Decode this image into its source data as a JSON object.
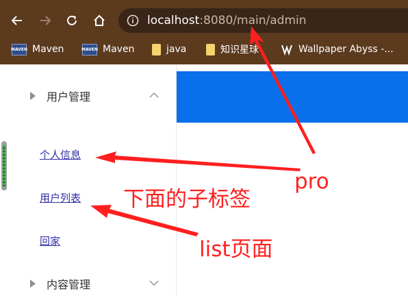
{
  "browser": {
    "url_host": "localhost",
    "url_rest": ":8080/main/admin",
    "bookmarks": [
      {
        "label": "Maven",
        "icon": "maven-icon"
      },
      {
        "label": "Maven",
        "icon": "maven-icon"
      },
      {
        "label": "java",
        "icon": "folder-icon"
      },
      {
        "label": "知识星球",
        "icon": "folder-icon"
      },
      {
        "label": "Wallpaper Abyss -...",
        "icon": "wallpaper-abyss-icon"
      }
    ],
    "maven_icon_text": "MAVEN"
  },
  "sidebar": {
    "menu_user": "用户管理",
    "sub_items": [
      "个人信息",
      "用户列表",
      "回家"
    ],
    "menu_content": "内容管理"
  },
  "annotations": {
    "pro": "pro",
    "sub_tags": "下面的子标签",
    "list_page": "list页面"
  },
  "colors": {
    "browser_chrome": "#5b3a1e",
    "header_band": "#0a6fea",
    "annotation_red": "#ff1f1f",
    "link": "#2f2fa8"
  }
}
